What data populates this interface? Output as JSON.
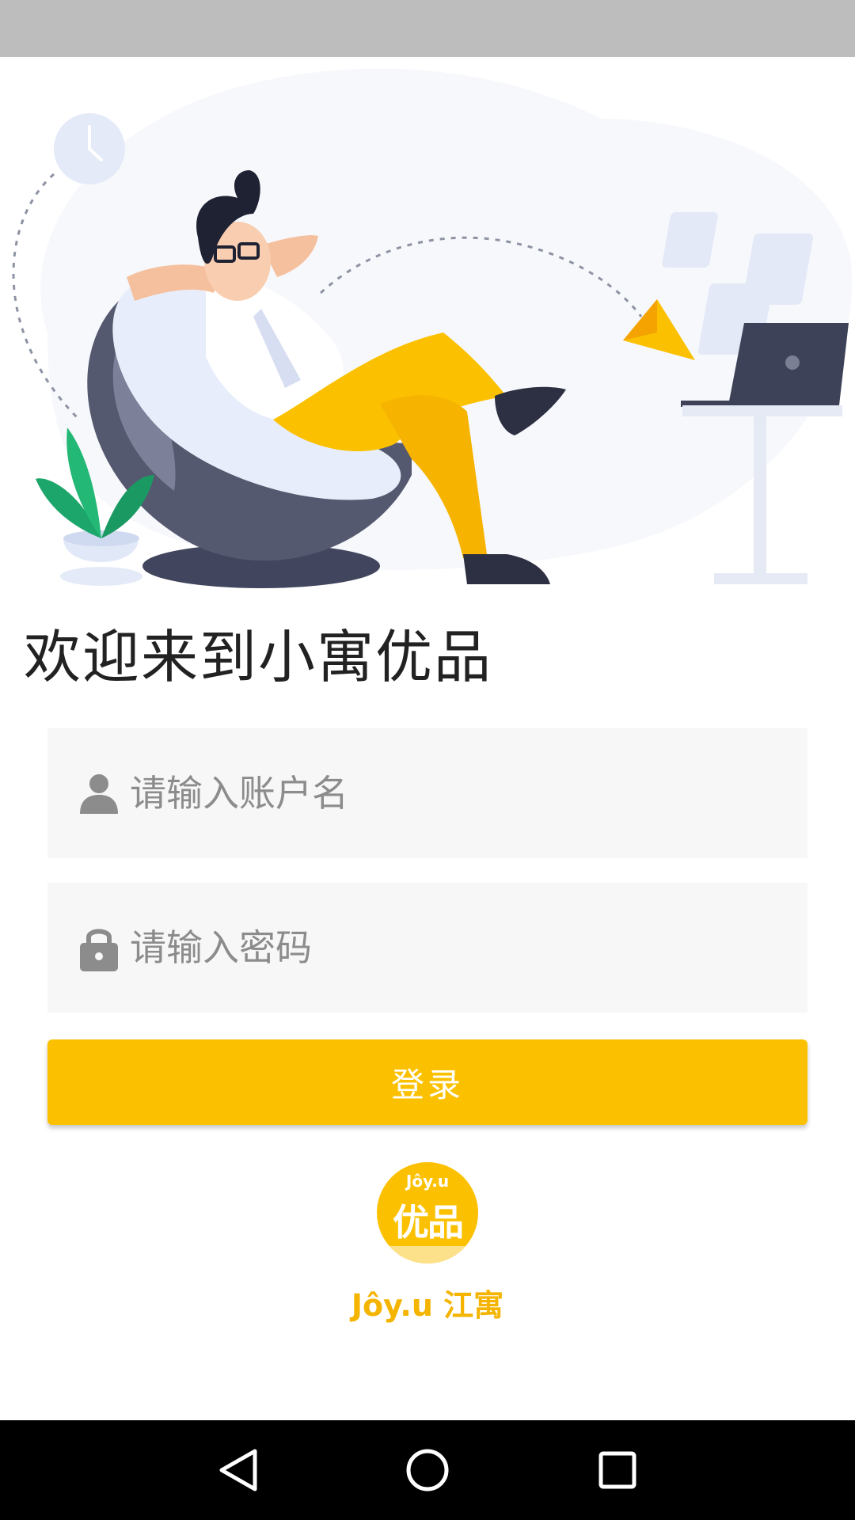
{
  "welcome": {
    "title": "欢迎来到小寓优品"
  },
  "form": {
    "username": {
      "placeholder": "请输入账户名",
      "icon": "person-icon"
    },
    "password": {
      "placeholder": "请输入密码",
      "icon": "lock-icon"
    },
    "login_label": "登录"
  },
  "logo": {
    "badge_small": "Jôy.u",
    "badge_big": "优品",
    "brand_text": "Jôy.u 江寓"
  },
  "navigation": {
    "back": "back-icon",
    "home": "home-icon",
    "recents": "recents-icon"
  },
  "colors": {
    "accent": "#fbc100",
    "status_bar": "#bdbdbd",
    "field_bg": "#f7f7f7",
    "nav_bar": "#000000"
  }
}
